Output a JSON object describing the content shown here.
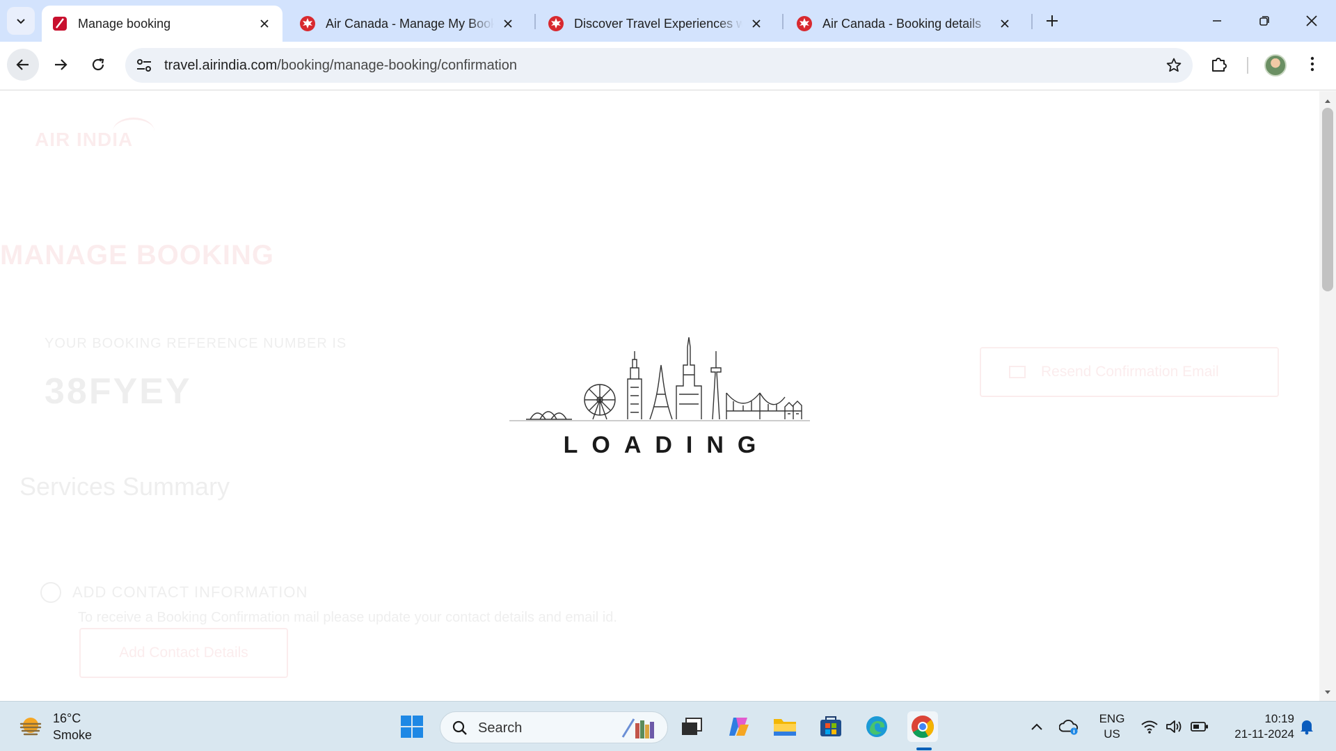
{
  "browser": {
    "tabs": [
      {
        "title": "Manage booking",
        "active": true,
        "favicon": "air-india-icon"
      },
      {
        "title": "Air Canada - Manage My Booking",
        "active": false,
        "favicon": "air-canada-icon"
      },
      {
        "title": "Discover Travel Experiences with Air Canada",
        "active": false,
        "favicon": "air-canada-icon"
      },
      {
        "title": "Air Canada - Booking details",
        "active": false,
        "favicon": "air-canada-icon"
      }
    ],
    "url": {
      "host": "travel.airindia.com",
      "path": "/booking/manage-booking/confirmation"
    }
  },
  "page": {
    "logo_text": "AIR INDIA",
    "heading": "MANAGE BOOKING",
    "booking_ref_label": "YOUR BOOKING REFERENCE NUMBER IS",
    "booking_ref": "38FYEY",
    "resend_button": "Resend Confirmation Email",
    "services_title": "Services Summary",
    "contact_title": "ADD CONTACT INFORMATION",
    "contact_desc": "To receive a Booking Confirmation mail please update your contact details and email id.",
    "add_contact_button": "Add Contact Details",
    "loading_text": "LOADING",
    "brand_color": "#d2232a"
  },
  "taskbar": {
    "weather_temp": "16°C",
    "weather_condition": "Smoke",
    "search_placeholder": "Search",
    "lang_primary": "ENG",
    "lang_secondary": "US",
    "time": "10:19",
    "date": "21-11-2024"
  }
}
